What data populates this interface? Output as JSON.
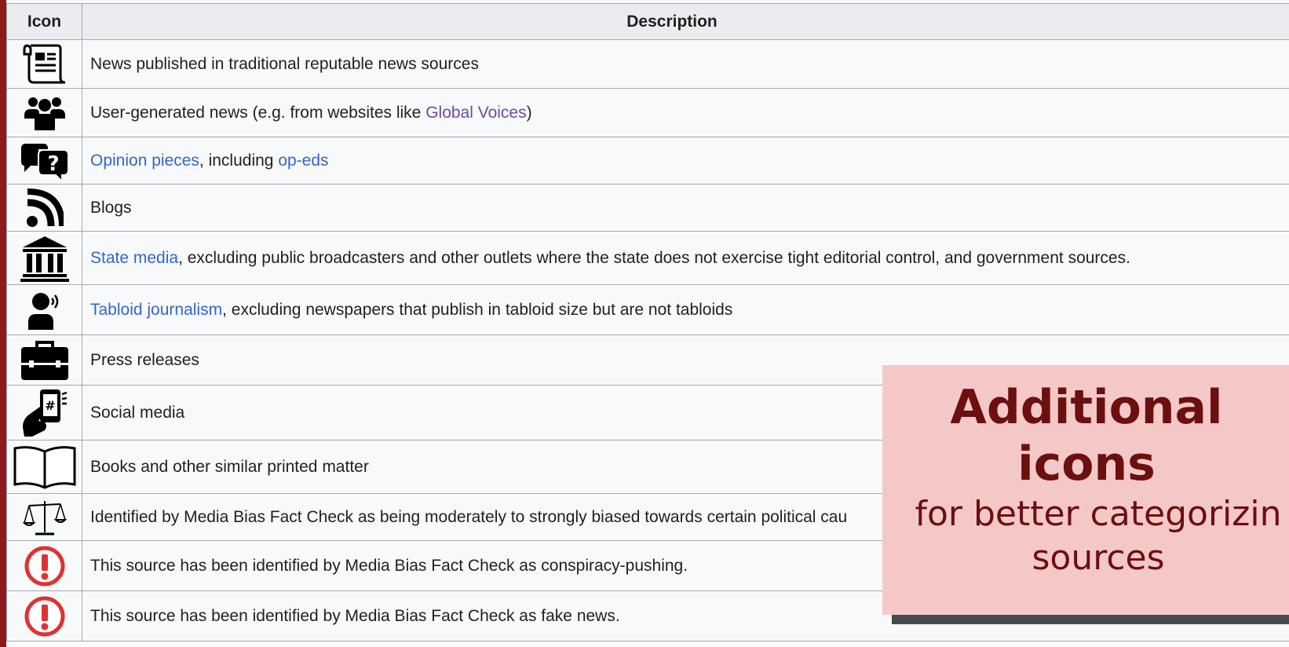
{
  "table": {
    "header_icon": "Icon",
    "header_description": "Description",
    "rows": [
      {
        "icon": "newspaper-icon",
        "text": "News published in traditional reputable news sources"
      },
      {
        "icon": "users-icon",
        "text_before": "User-generated news (e.g. from websites like ",
        "link": "Global Voices",
        "text_after": ")"
      },
      {
        "icon": "speech-bubble-question-icon",
        "link": "Opinion pieces",
        "text_mid": ", including ",
        "link2": "op-eds"
      },
      {
        "icon": "rss-icon",
        "text": "Blogs"
      },
      {
        "icon": "government-building-icon",
        "link": "State media",
        "text_after": ", excluding public broadcasters and other outlets where the state does not exercise tight editorial control, and government sources."
      },
      {
        "icon": "person-speaking-icon",
        "link": "Tabloid journalism",
        "text_after": ", excluding newspapers that publish in tabloid size but are not tabloids"
      },
      {
        "icon": "briefcase-icon",
        "text": "Press releases"
      },
      {
        "icon": "phone-in-hand-icon",
        "text": "Social media"
      },
      {
        "icon": "open-book-icon",
        "text": "Books and other similar printed matter"
      },
      {
        "icon": "scales-icon",
        "text": "Identified by Media Bias Fact Check as being moderately to strongly biased towards certain political cau"
      },
      {
        "icon": "exclamation-circle-icon",
        "text": "This source has been identified by Media Bias Fact Check as conspiracy-pushing."
      },
      {
        "icon": "exclamation-circle-icon",
        "text": "This source has been identified by Media Bias Fact Check as fake news."
      }
    ]
  },
  "overlay": {
    "title_line1": "Additional",
    "title_line2": "icons",
    "subtitle_line1": "for better categorizin",
    "subtitle_line2": "sources"
  },
  "colors": {
    "link": "#3366cc",
    "visited_link": "#6b4ba1",
    "alert_red": "#d33",
    "overlay_bg": "#f5c8c8",
    "overlay_text": "#6b0f0f",
    "frame_border": "#8b1a1a"
  }
}
